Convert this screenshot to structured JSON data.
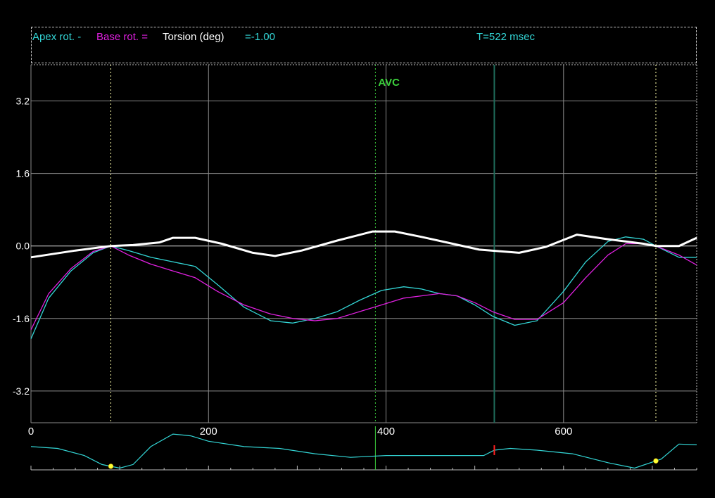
{
  "header": {
    "apex_label": "Apex rot. -",
    "base_label": "Base rot. =",
    "torsion_label": "Torsion (deg)",
    "torsion_value": "=-1.00",
    "time_readout": "T=522 msec"
  },
  "colors": {
    "background": "#000000",
    "apex": "#33d6d6",
    "base": "#e020e0",
    "torsion": "#ffffff",
    "grid": "#8a8a8a",
    "avc_marker": "#3ccf3c",
    "cursor": "#1e6b5a",
    "ecg": "#33d6d6",
    "ecg_dot": "#ffff33",
    "ecg_cursor_tick": "#ff2020"
  },
  "chart_data": {
    "type": "line",
    "xlabel": "",
    "ylabel": "",
    "xlim": [
      0,
      750
    ],
    "ylim": [
      -3.9,
      4.0
    ],
    "grid": true,
    "x_ticks": [
      0,
      200,
      400,
      600
    ],
    "y_ticks": [
      3.2,
      1.6,
      0.0,
      -1.6,
      -3.2
    ],
    "y_tick_labels": [
      "3.2",
      "1.6",
      "0.0",
      "-1.6",
      "-3.2"
    ],
    "avc": {
      "label": "AVC",
      "x": 388
    },
    "cursor_x": 522,
    "cycle_markers": [
      90,
      704
    ],
    "series": [
      {
        "name": "Apex rot.",
        "x": [
          0,
          20,
          45,
          70,
          90,
          110,
          135,
          160,
          185,
          210,
          240,
          270,
          295,
          320,
          345,
          370,
          395,
          420,
          440,
          460,
          480,
          500,
          520,
          545,
          570,
          600,
          625,
          650,
          670,
          690,
          704,
          730,
          750
        ],
        "values": [
          -2.05,
          -1.15,
          -0.55,
          -0.15,
          0.0,
          -0.1,
          -0.25,
          -0.35,
          -0.45,
          -0.85,
          -1.35,
          -1.65,
          -1.7,
          -1.6,
          -1.45,
          -1.2,
          -0.98,
          -0.9,
          -0.95,
          -1.05,
          -1.1,
          -1.3,
          -1.55,
          -1.75,
          -1.65,
          -1.0,
          -0.35,
          0.1,
          0.2,
          0.15,
          0.0,
          -0.25,
          -0.25
        ]
      },
      {
        "name": "Base rot.",
        "x": [
          0,
          20,
          45,
          70,
          90,
          110,
          135,
          160,
          185,
          210,
          240,
          270,
          295,
          320,
          345,
          370,
          395,
          420,
          440,
          460,
          480,
          500,
          520,
          545,
          570,
          600,
          625,
          650,
          670,
          690,
          704,
          730,
          750
        ],
        "values": [
          -1.85,
          -1.05,
          -0.5,
          -0.12,
          0.0,
          -0.2,
          -0.4,
          -0.55,
          -0.7,
          -1.0,
          -1.3,
          -1.5,
          -1.6,
          -1.65,
          -1.6,
          -1.45,
          -1.3,
          -1.15,
          -1.1,
          -1.05,
          -1.1,
          -1.25,
          -1.45,
          -1.62,
          -1.62,
          -1.25,
          -0.7,
          -0.2,
          0.05,
          0.05,
          0.0,
          -0.2,
          -0.42
        ]
      },
      {
        "name": "Torsion",
        "x": [
          0,
          50,
          90,
          115,
          145,
          160,
          185,
          215,
          250,
          275,
          305,
          345,
          385,
          410,
          440,
          475,
          505,
          550,
          580,
          615,
          650,
          690,
          704,
          730,
          750
        ],
        "values": [
          -0.25,
          -0.1,
          0.0,
          0.02,
          0.08,
          0.18,
          0.18,
          0.05,
          -0.15,
          -0.22,
          -0.1,
          0.12,
          0.32,
          0.32,
          0.2,
          0.05,
          -0.08,
          -0.15,
          -0.02,
          0.25,
          0.15,
          0.05,
          0.0,
          0.0,
          0.18
        ]
      }
    ],
    "ecg": {
      "x": [
        0,
        30,
        60,
        80,
        100,
        115,
        135,
        160,
        180,
        200,
        240,
        280,
        320,
        360,
        400,
        440,
        480,
        510,
        522,
        540,
        570,
        610,
        650,
        680,
        710,
        730,
        750
      ],
      "values": [
        0.55,
        0.5,
        0.3,
        0.05,
        -0.05,
        0.05,
        0.55,
        0.9,
        0.85,
        0.7,
        0.55,
        0.5,
        0.35,
        0.25,
        0.3,
        0.3,
        0.3,
        0.3,
        0.45,
        0.5,
        0.45,
        0.35,
        0.1,
        -0.05,
        0.2,
        0.62,
        0.6
      ],
      "dots_x": [
        90,
        704
      ]
    }
  }
}
